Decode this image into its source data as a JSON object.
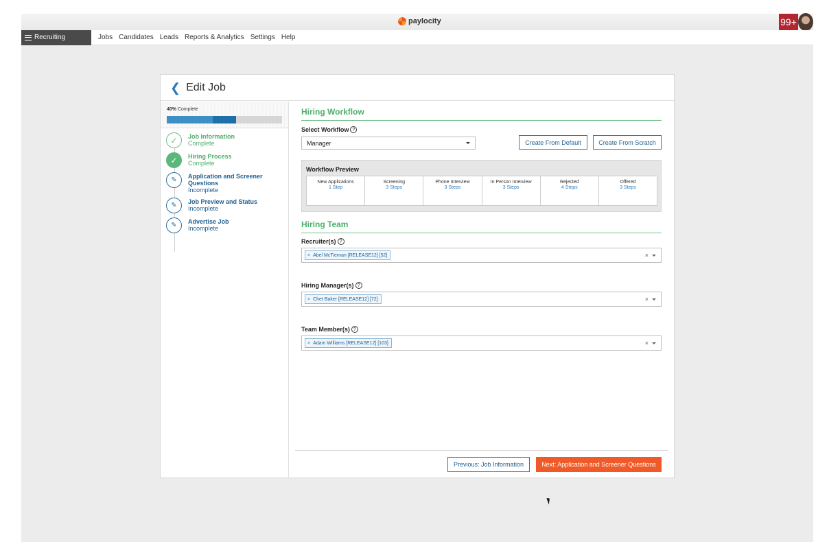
{
  "brand": {
    "name": "paylocity"
  },
  "header": {
    "notifications": "99+"
  },
  "nav": {
    "module_label": "Recruiting",
    "items": [
      "Jobs",
      "Candidates",
      "Leads",
      "Reports & Analytics",
      "Settings",
      "Help"
    ]
  },
  "page": {
    "title": "Edit Job",
    "back_icon": "chevron-left-icon"
  },
  "progress": {
    "percent_label": "40%",
    "complete_label": "Complete",
    "value": 0.6,
    "current_segment_start": 0.4,
    "current_segment_end": 0.6
  },
  "steps": [
    {
      "title": "Job Information",
      "status": "Complete",
      "state": "complete"
    },
    {
      "title": "Hiring Process",
      "status": "Complete",
      "state": "active"
    },
    {
      "title": "Application and Screener Questions",
      "status": "Incomplete",
      "state": "incomplete"
    },
    {
      "title": "Job Preview and Status",
      "status": "Incomplete",
      "state": "incomplete"
    },
    {
      "title": "Advertise Job",
      "status": "Incomplete",
      "state": "incomplete"
    }
  ],
  "hiring_workflow": {
    "title": "Hiring Workflow",
    "select_label": "Select Workflow",
    "selected": "Manager",
    "create_default": "Create From Default",
    "create_scratch": "Create From Scratch",
    "preview_title": "Workflow Preview",
    "stages": [
      {
        "name": "New Applications",
        "count": "1 Step"
      },
      {
        "name": "Screening",
        "count": "3 Steps"
      },
      {
        "name": "Phone Interview",
        "count": "3 Steps"
      },
      {
        "name": "In Person Interview",
        "count": "3 Steps"
      },
      {
        "name": "Rejected",
        "count": "4 Steps"
      },
      {
        "name": "Offered",
        "count": "3 Steps"
      }
    ]
  },
  "hiring_team": {
    "title": "Hiring Team",
    "recruiters_label": "Recruiter(s)",
    "recruiter": "Abel McTiernan [RELEASE12] [52]",
    "managers_label": "Hiring Manager(s)",
    "manager": "Chet Baker [RELEASE12] [72]",
    "members_label": "Team Member(s)",
    "member": "Adam Williams [RELEASE12] [103]",
    "tag_remove": "×",
    "clear": "×"
  },
  "footer": {
    "previous": "Previous: Job Information",
    "next": "Next: Application and Screener Questions"
  },
  "colors": {
    "accent_green": "#4caf6a",
    "accent_blue": "#2a7ab8",
    "primary_orange": "#f05a28"
  }
}
